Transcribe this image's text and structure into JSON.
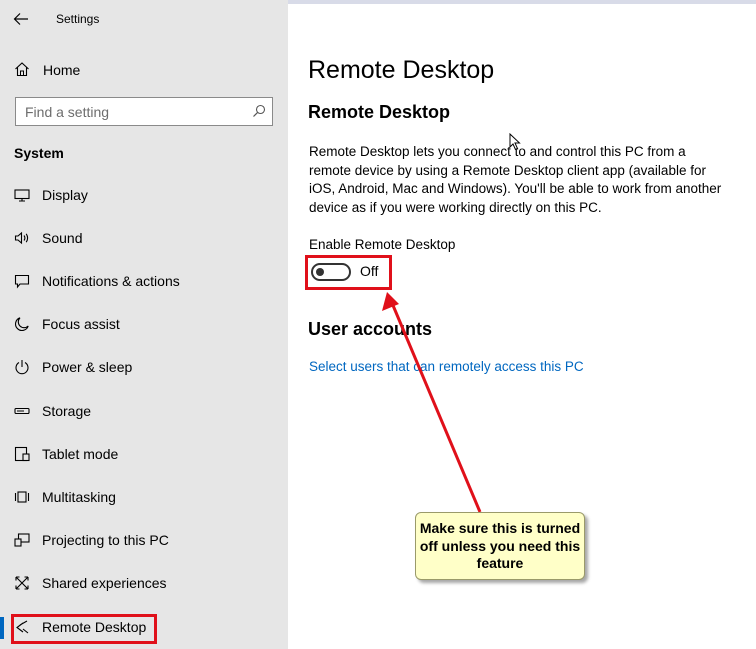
{
  "app": {
    "title": "Settings"
  },
  "sidebar": {
    "home_label": "Home",
    "search_placeholder": "Find a setting",
    "section_label": "System",
    "items": [
      {
        "label": "Display",
        "icon": "display-icon"
      },
      {
        "label": "Sound",
        "icon": "sound-icon"
      },
      {
        "label": "Notifications & actions",
        "icon": "notifications-icon"
      },
      {
        "label": "Focus assist",
        "icon": "moon-icon"
      },
      {
        "label": "Power & sleep",
        "icon": "power-icon"
      },
      {
        "label": "Storage",
        "icon": "storage-icon"
      },
      {
        "label": "Tablet mode",
        "icon": "tablet-icon"
      },
      {
        "label": "Multitasking",
        "icon": "multitasking-icon"
      },
      {
        "label": "Projecting to this PC",
        "icon": "projecting-icon"
      },
      {
        "label": "Shared experiences",
        "icon": "shared-icon"
      },
      {
        "label": "Remote Desktop",
        "icon": "remote-desktop-icon"
      }
    ],
    "active_item": "Remote Desktop"
  },
  "main": {
    "page_title": "Remote Desktop",
    "section_title": "Remote Desktop",
    "description": "Remote Desktop lets you connect to and control this PC from a remote device by using a Remote Desktop client app (available for iOS, Android, Mac and Windows). You'll be able to work from another device as if you were working directly on this PC.",
    "enable_label": "Enable Remote Desktop",
    "toggle_state": "Off",
    "accounts_title": "User accounts",
    "accounts_link": "Select users that can remotely access this PC"
  },
  "annotation": {
    "callout_text": "Make sure this is turned off unless you need this feature",
    "highlight_color": "#e0101a",
    "callout_color": "#ffffc8"
  },
  "colors": {
    "accent": "#0067c0",
    "sidebar_bg": "#e6e6e6"
  }
}
